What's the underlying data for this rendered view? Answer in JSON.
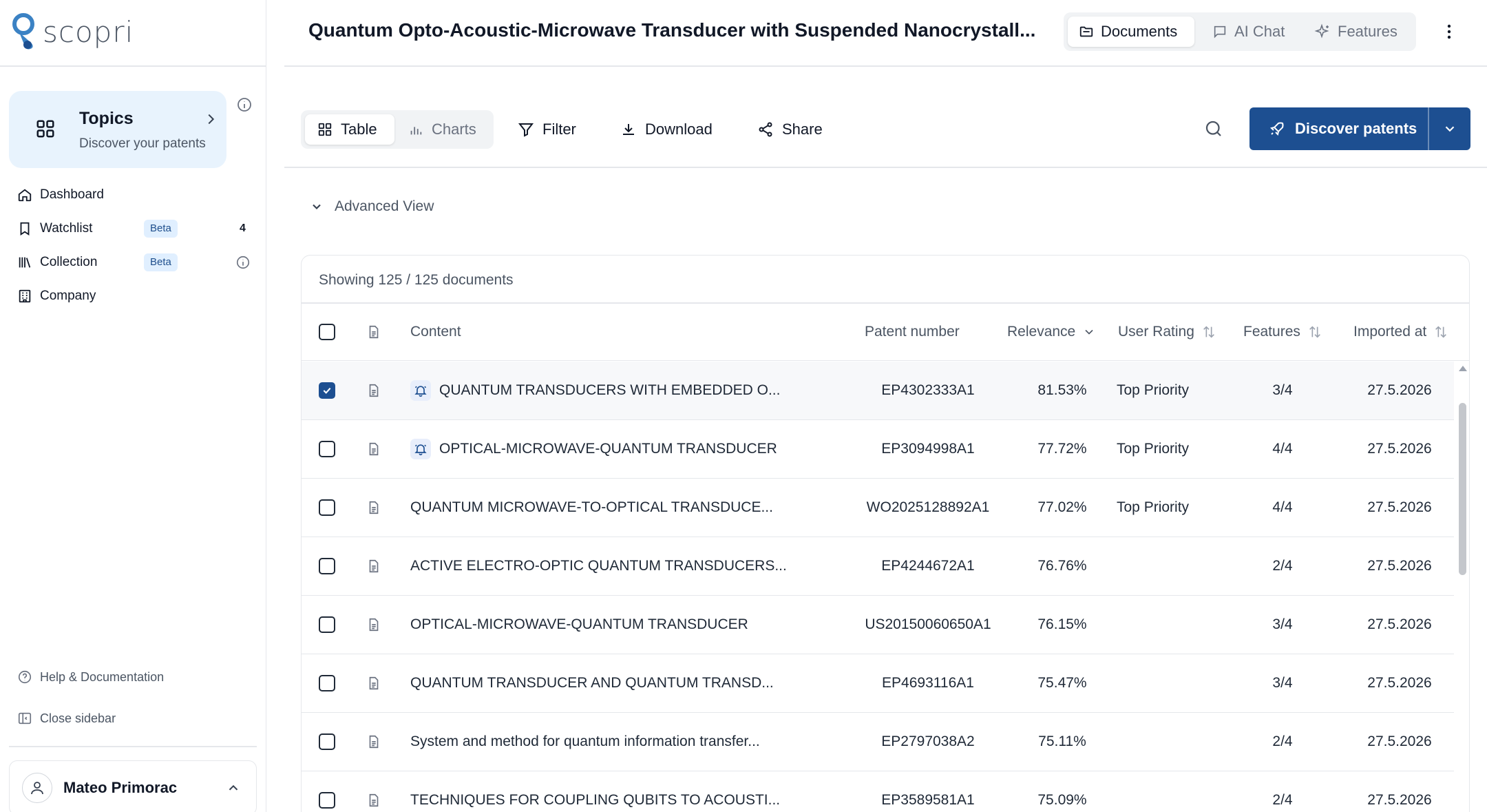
{
  "brand": {
    "name": "scopri"
  },
  "sidebar": {
    "topics": {
      "title": "Topics",
      "subtitle": "Discover your patents"
    },
    "items": [
      {
        "label": "Dashboard",
        "icon": "home-icon"
      },
      {
        "label": "Watchlist",
        "icon": "bookmark-icon",
        "badge": "Beta",
        "count": "4"
      },
      {
        "label": "Collection",
        "icon": "library-icon",
        "badge": "Beta"
      },
      {
        "label": "Company",
        "icon": "building-icon"
      }
    ],
    "help_label": "Help & Documentation",
    "close_label": "Close sidebar",
    "user": {
      "name": "Mateo Primorac"
    }
  },
  "header": {
    "title": "Quantum Opto-Acoustic-Microwave Transducer with Suspended Nanocrystall...",
    "views": [
      {
        "label": "Documents",
        "active": true
      },
      {
        "label": "AI Chat",
        "active": false
      },
      {
        "label": "Features",
        "active": false
      }
    ]
  },
  "toolbar": {
    "table_label": "Table",
    "charts_label": "Charts",
    "filter_label": "Filter",
    "download_label": "Download",
    "share_label": "Share",
    "discover_label": "Discover patents"
  },
  "advanced_view_label": "Advanced View",
  "table": {
    "showing": "Showing 125 / 125 documents",
    "columns": {
      "content": "Content",
      "patent_number": "Patent number",
      "relevance": "Relevance",
      "user_rating": "User Rating",
      "features": "Features",
      "imported_at": "Imported at"
    },
    "rows": [
      {
        "checked": true,
        "bell": true,
        "content": "QUANTUM TRANSDUCERS WITH EMBEDDED O...",
        "patent_number": "EP4302333A1",
        "relevance": "81.53%",
        "user_rating": "Top Priority",
        "features": "3/4",
        "imported_at": "27.5.2026"
      },
      {
        "checked": false,
        "bell": true,
        "content": "OPTICAL-MICROWAVE-QUANTUM TRANSDUCER",
        "patent_number": "EP3094998A1",
        "relevance": "77.72%",
        "user_rating": "Top Priority",
        "features": "4/4",
        "imported_at": "27.5.2026"
      },
      {
        "checked": false,
        "bell": false,
        "content": "QUANTUM MICROWAVE-TO-OPTICAL TRANSDUCE...",
        "patent_number": "WO2025128892A1",
        "relevance": "77.02%",
        "user_rating": "Top Priority",
        "features": "4/4",
        "imported_at": "27.5.2026"
      },
      {
        "checked": false,
        "bell": false,
        "content": "ACTIVE ELECTRO-OPTIC QUANTUM TRANSDUCERS...",
        "patent_number": "EP4244672A1",
        "relevance": "76.76%",
        "user_rating": "",
        "features": "2/4",
        "imported_at": "27.5.2026"
      },
      {
        "checked": false,
        "bell": false,
        "content": "OPTICAL-MICROWAVE-QUANTUM TRANSDUCER",
        "patent_number": "US20150060650A1",
        "relevance": "76.15%",
        "user_rating": "",
        "features": "3/4",
        "imported_at": "27.5.2026"
      },
      {
        "checked": false,
        "bell": false,
        "content": "QUANTUM TRANSDUCER AND QUANTUM TRANSD...",
        "patent_number": "EP4693116A1",
        "relevance": "75.47%",
        "user_rating": "",
        "features": "3/4",
        "imported_at": "27.5.2026"
      },
      {
        "checked": false,
        "bell": false,
        "content": "System and method for quantum information transfer...",
        "patent_number": "EP2797038A2",
        "relevance": "75.11%",
        "user_rating": "",
        "features": "2/4",
        "imported_at": "27.5.2026"
      },
      {
        "checked": false,
        "bell": false,
        "content": "TECHNIQUES FOR COUPLING QUBITS TO ACOUSTI...",
        "patent_number": "EP3589581A1",
        "relevance": "75.09%",
        "user_rating": "",
        "features": "2/4",
        "imported_at": "27.5.2026"
      }
    ]
  },
  "colors": {
    "primary": "#1d4f91",
    "topics_bg": "#e8f3fd",
    "badge_bg": "#e0efff"
  }
}
